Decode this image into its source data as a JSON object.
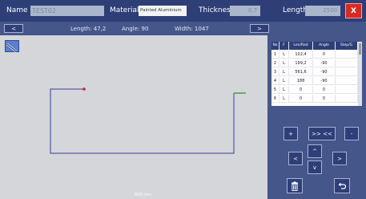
{
  "header": {
    "name_label": "Name",
    "name_value": "TEST02",
    "material_label": "Material",
    "material_value": "Painted Aluminium",
    "thickness_label": "Thickness",
    "thickness_value": "0,7",
    "length_label": "Length",
    "length_value": "2500",
    "close_label": "X"
  },
  "infobar": {
    "prev_label": "<",
    "next_label": ">",
    "length_text": "Length: 47,2",
    "angle_text": "Angle: 90",
    "width_text": "Width: 1047"
  },
  "canvas": {
    "scale_label": "800 mm",
    "pen_icon": "pen-icon"
  },
  "table": {
    "headers": [
      "No",
      "F",
      "Len/Rad",
      "Angle",
      "Step/G"
    ],
    "rows": [
      [
        "1",
        "L",
        "102,4",
        "0",
        ""
      ],
      [
        "2",
        "L",
        "199,2",
        "-90",
        ""
      ],
      [
        "3",
        "L",
        "561,6",
        "-90",
        ""
      ],
      [
        "4",
        "L",
        "188",
        "-90",
        ""
      ],
      [
        "5",
        "L",
        "0",
        "0",
        ""
      ],
      [
        "6",
        "L",
        "0",
        "0",
        ""
      ]
    ]
  },
  "controls": {
    "plus_label": "+",
    "swap_label": ">> <<",
    "minus_label": "-",
    "left_label": "<",
    "up_label": "^",
    "right_label": ">",
    "down_label": "v",
    "trash_icon": "trash-icon",
    "undo_icon": "undo-icon"
  },
  "colors": {
    "header_bg": "#2e3f78",
    "panel_bg": "#45568b",
    "canvas_bg": "#d4d6d9",
    "close_red": "#d92b22",
    "profile_blue": "#3a3f9e",
    "profile_green": "#3c9a3c",
    "start_dot_red": "#d82020"
  }
}
